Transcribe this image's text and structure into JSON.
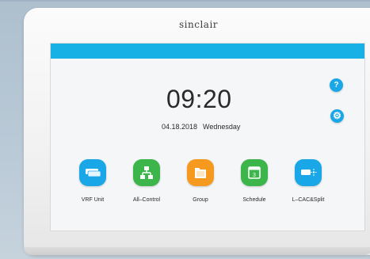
{
  "device": {
    "brand": "sinclair"
  },
  "screen": {
    "time": "09:20",
    "date": "04.18.2018",
    "weekday": "Wednesday",
    "help_icon": "?",
    "settings_icon": "⚙"
  },
  "tiles": [
    {
      "label": "VRF Unit",
      "icon": "ac-unit-icon",
      "color": "#1aa7e8"
    },
    {
      "label": "All–Control",
      "icon": "network-icon",
      "color": "#3cb54a"
    },
    {
      "label": "Group",
      "icon": "folder-icon",
      "color": "#f59a1f"
    },
    {
      "label": "Schedule",
      "icon": "calendar-icon",
      "color": "#3cb54a"
    },
    {
      "label": "L–CAC&Split",
      "icon": "split-unit-icon",
      "color": "#1aa7e8"
    }
  ],
  "colors": {
    "status_bar": "#17b1e6",
    "accent_blue": "#1aa7e8",
    "accent_green": "#3cb54a",
    "accent_orange": "#f59a1f"
  }
}
